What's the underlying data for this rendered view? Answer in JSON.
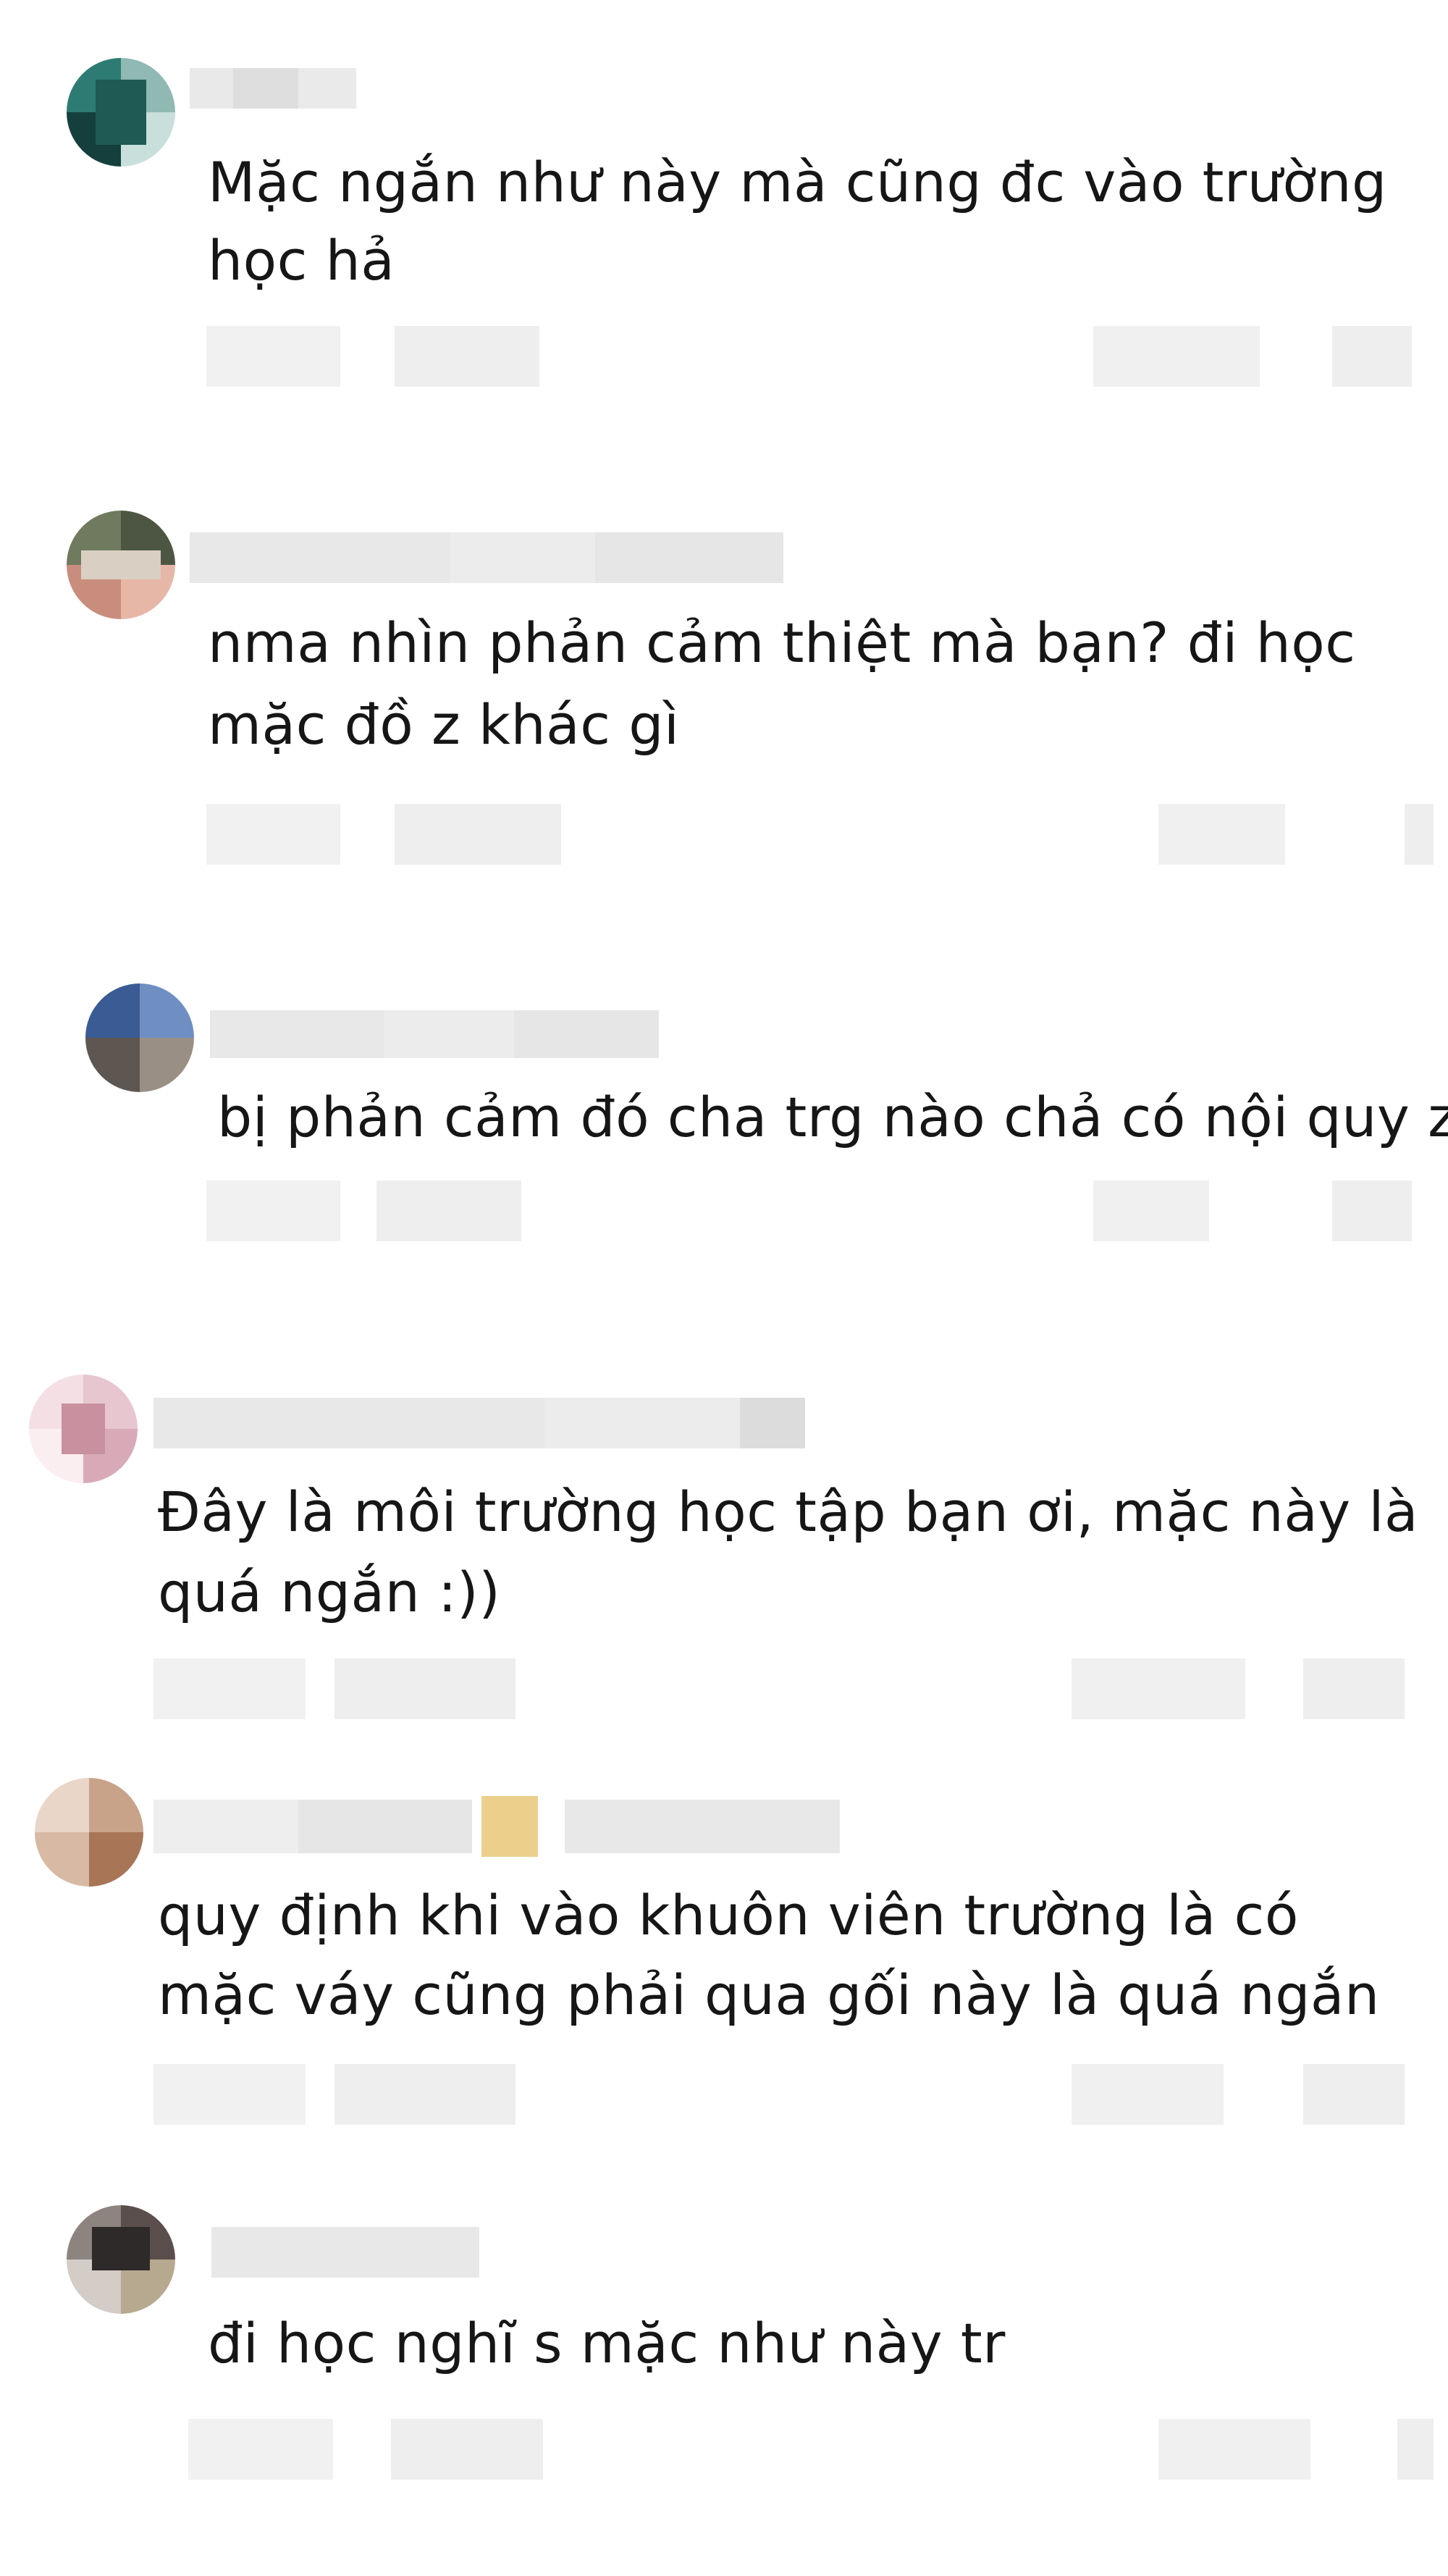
{
  "comments": [
    {
      "line1": "Mặc ngắn như này mà cũng đc vào trường",
      "line2": "học hả",
      "avatar_colors": [
        "#1f5a55",
        "#2d7c74",
        "#8fb9b2",
        "#c8dfdb",
        "#153f3c",
        "#5e9690"
      ]
    },
    {
      "line1": "nma nhìn phản cảm thiệt mà bạn? đi học",
      "line2": "mặc đồ z khác gì",
      "avatar_colors": [
        "#6f7a5e",
        "#b7c2a8",
        "#c98d7d",
        "#e6b6a7",
        "#8d5a4c",
        "#d9cfc2"
      ]
    },
    {
      "line1": "bị phản cảm đó cha trg nào chả có nội quy z",
      "line2": "",
      "avatar_colors": [
        "#3a5b93",
        "#6f8fc3",
        "#9a8f85",
        "#5e5751",
        "#c9c2bb",
        "#7c6f66"
      ]
    },
    {
      "line1": "Đây là môi trường học tập bạn ơi, mặc này là",
      "line2": "quá ngắn :))",
      "avatar_colors": [
        "#f3dfe4",
        "#c9909f",
        "#e8c6cf",
        "#b77a8b",
        "#faeef1",
        "#d8aab7"
      ]
    },
    {
      "line1": "quy định khi vào khuôn viên trường là có",
      "line2": "mặc váy cũng phải qua gối này là quá ngắn",
      "avatar_colors": [
        "#c9a28a",
        "#e9d6c8",
        "#a87557",
        "#d8b9a3",
        "#f3e8e0",
        "#8f6a55"
      ]
    },
    {
      "line1": "đi học nghĩ s mặc như này tr",
      "line2": "",
      "avatar_colors": [
        "#5a4f4c",
        "#8d8480",
        "#b7a890",
        "#2f2a2a",
        "#d3ccc7",
        "#7a6c58"
      ]
    }
  ]
}
